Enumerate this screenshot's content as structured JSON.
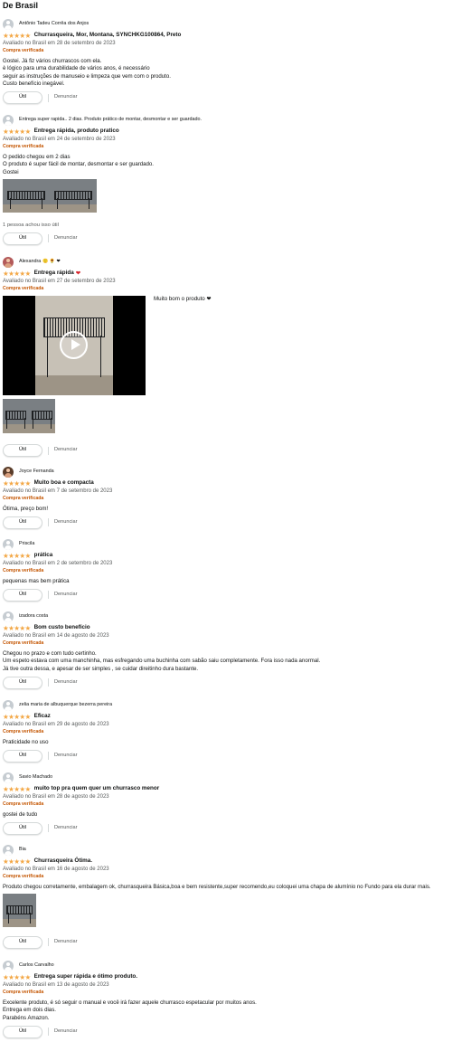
{
  "section_title": "De Brasil",
  "buttons": {
    "util": "Útil",
    "denunciar": "Denunciar"
  },
  "reviews": [
    {
      "name": "Antônio Tadeu Corrêa dos Anjos",
      "stars": "★★★★★",
      "title": "Churrasqueira, Mor, Montana, SYNCHKG100864, Preto",
      "date": "Avaliado no Brasil em 28 de setembro de 2023",
      "verified": "Compra verificada",
      "body": "Gostei. Já fiz vários churrascos com ela.\nè lógico para uma durabilidade de vários anos, é necessário\nseguir as instruções de manuseio e limpeza que vem com o produto.\nCusto benefício inegável."
    },
    {
      "name": "Entrega super rapida.. 2 dias. Produto prático de montar, desmontar e ser guardado.",
      "stars": "★★★★★",
      "title": "Entrega rápida, produto pratico",
      "date": "Avaliado no Brasil em 24 de setembro de 2023",
      "verified": "Compra verificada",
      "body": "O pedido chegou em 2 dias\nO produto é super fácil de montar, desmontar e ser guardado.\nGostei",
      "helpful": "1 pessoa achou isso útil"
    },
    {
      "name": "Alexandra",
      "badge": "🙂 🌻 ❤",
      "stars": "★★★★★",
      "title": "Entrega rápida",
      "heart": "❤",
      "date": "Avaliado no Brasil em 27 de setembro de 2023",
      "verified": "Compra verificada",
      "body": "Muito bom o produto ❤"
    },
    {
      "name": "Joyce Fernanda",
      "stars": "★★★★★",
      "title": "Muito boa e compacta",
      "date": "Avaliado no Brasil em 7 de setembro de 2023",
      "verified": "Compra verificada",
      "body": "Ótima, preço bom!"
    },
    {
      "name": "Priscila",
      "stars": "★★★★★",
      "title": "prática",
      "date": "Avaliado no Brasil em 2 de setembro de 2023",
      "verified": "Compra verificada",
      "body": "pequenas mas bem prática"
    },
    {
      "name": "izadora costa",
      "stars": "★★★★★",
      "title": "Bom custo benefício",
      "date": "Avaliado no Brasil em 14 de agosto de 2023",
      "verified": "Compra verificada",
      "body": "Chegou no prazo e com tudo certinho.\nUm espeto estava com uma manchinha, mas esfregando uma buchinha com sabão saiu completamente. Fora isso nada anormal.\nJá tive outra dessa, e apesar de ser simples , se cuidar direitinho dura bastante."
    },
    {
      "name": "zelia maria de albuquerque bezerra pereira",
      "stars": "★★★★★",
      "title": "Eficaz",
      "date": "Avaliado no Brasil em 29 de agosto de 2023",
      "verified": "Compra verificada",
      "body": "Praticidade no uso"
    },
    {
      "name": "Savio Machado",
      "stars": "★★★★★",
      "title": "muito top pra quem quer um churrasco menor",
      "date": "Avaliado no Brasil em 28 de agosto de 2023",
      "verified": "Compra verificada",
      "body": "gostei de tudo"
    },
    {
      "name": "Bia",
      "stars": "★★★★★",
      "title": "Churrasqueira Ótima.",
      "date": "Avaliado no Brasil em 16 de agosto de 2023",
      "verified": "Compra verificada",
      "body": "Produto chegou corretamente, embalagem ok, churrasqueira Básica,boa e bem resistente,super recomendo,eu coloquei uma chapa de alumínio no Fundo para ela durar mais."
    },
    {
      "name": "Carlos Carvalho",
      "stars": "★★★★★",
      "title": "Entrega super rápida e ótimo produto.",
      "date": "Avaliado no Brasil em 13 de agosto de 2023",
      "verified": "Compra verificada",
      "body": "Excelente produto, é só seguir o manual e você irá fazer aquele churrasco espetacular por muitos anos.\nEntrega em dois dias.\nParabéns Amazon."
    }
  ]
}
